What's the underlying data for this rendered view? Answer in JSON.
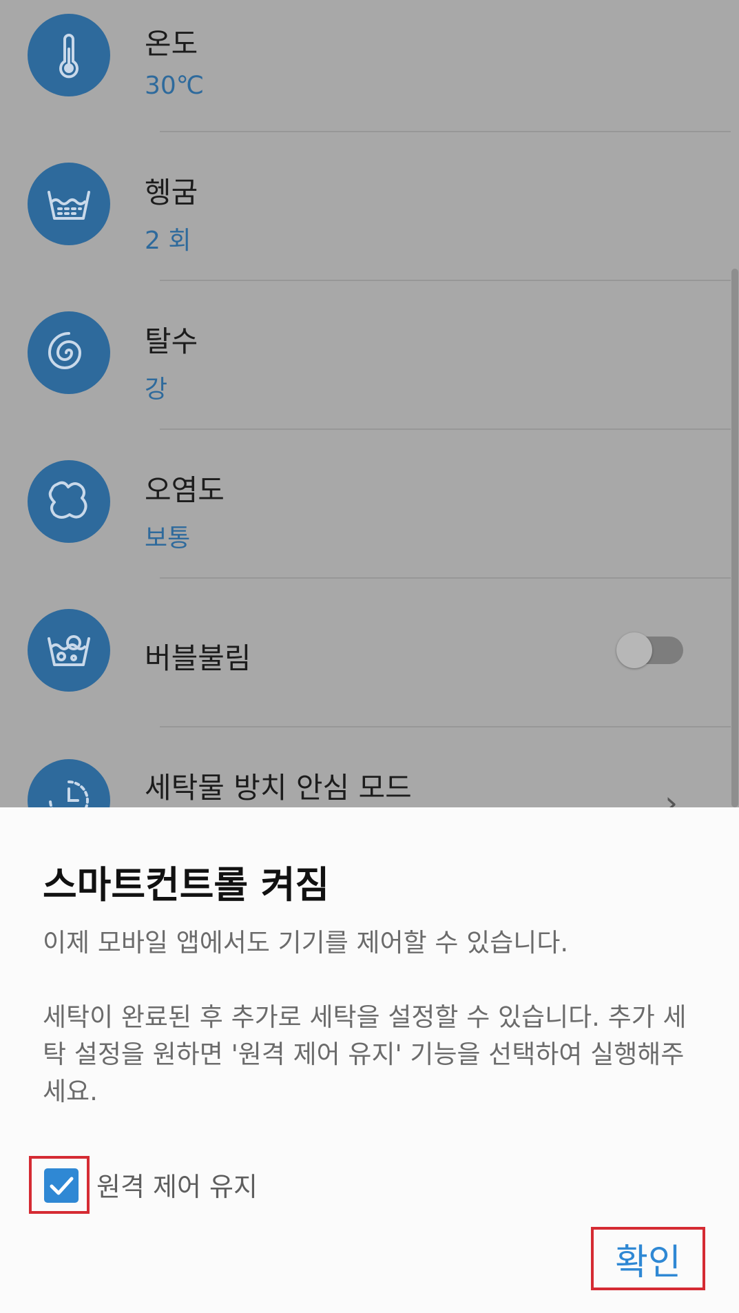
{
  "settings": {
    "items": [
      {
        "title": "온도",
        "value": "30℃",
        "icon": "thermometer-icon"
      },
      {
        "title": "헹굼",
        "value": "2 회",
        "icon": "rinse-tub-icon"
      },
      {
        "title": "탈수",
        "value": "강",
        "icon": "spin-swirl-icon"
      },
      {
        "title": "오염도",
        "value": "보통",
        "icon": "stain-icon"
      },
      {
        "title": "버블불림",
        "icon": "bubble-soak-icon",
        "toggle": "off"
      },
      {
        "title": "세탁물 방치 안심 모드",
        "icon": "timer-clock-icon"
      }
    ]
  },
  "dialog": {
    "title": "스마트컨트롤 켜짐",
    "paragraph1": "이제 모바일 앱에서도 기기를 제어할 수 있습니다.",
    "paragraph2": "세탁이 완료된 후 추가로 세탁을 설정할 수 있습니다. 추가 세탁 설정을 원하면 '원격 제어 유지' 기능을 선택하여 실행해주세요.",
    "checkbox_label": "원격 제어 유지",
    "checkbox_checked": true,
    "confirm_label": "확인"
  },
  "colors": {
    "accent": "#2f88d4",
    "icon_circle": "#2e6a9c",
    "highlight_border": "#d52b33"
  }
}
